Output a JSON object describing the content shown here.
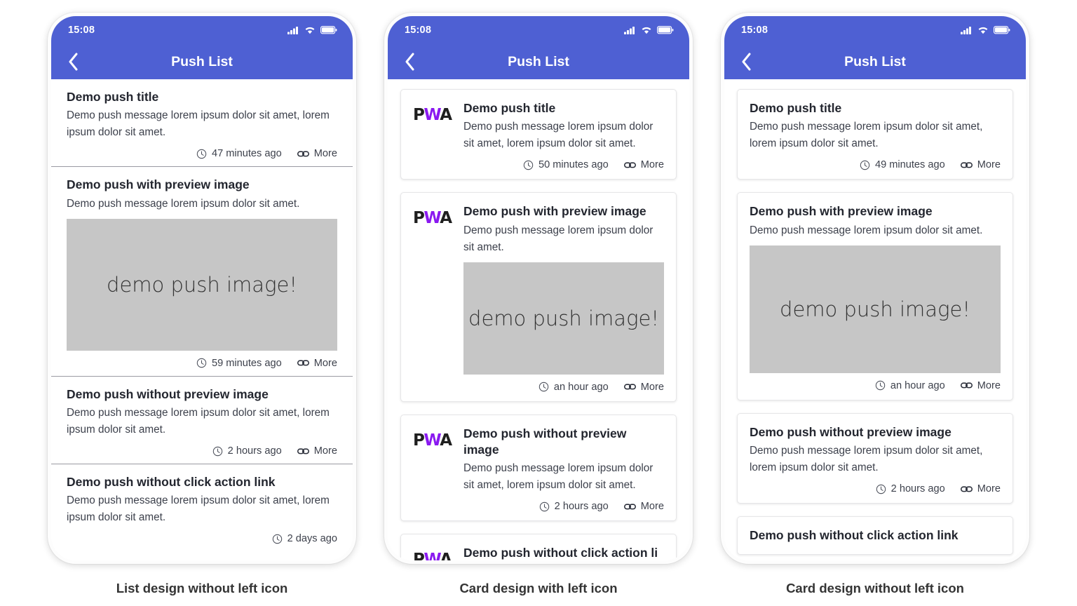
{
  "phones": [
    {
      "id": "list-design",
      "caption": "List design without left icon",
      "design": "list",
      "status": {
        "time": "15:08",
        "signal_icon": "signal-bars-icon",
        "wifi_icon": "wifi-icon",
        "battery_icon": "battery-icon"
      },
      "appbar": {
        "back_icon": "back-chevron-icon",
        "title": "Push List"
      },
      "items": [
        {
          "title": "Demo push title",
          "body": "Demo push message lorem ipsum dolor sit amet, lorem ipsum dolor sit amet.",
          "image": null,
          "time": "47 minutes ago",
          "more": "More"
        },
        {
          "title": "Demo push with preview image",
          "body": "Demo push message lorem ipsum dolor sit amet.",
          "image": "demo push image!",
          "time": "59 minutes ago",
          "more": "More"
        },
        {
          "title": "Demo push without preview image",
          "body": "Demo push message lorem ipsum dolor sit amet, lorem ipsum dolor sit amet.",
          "image": null,
          "time": "2 hours ago",
          "more": "More"
        },
        {
          "title": "Demo push without click action link",
          "body": "Demo push message lorem ipsum dolor sit amet, lorem ipsum dolor sit amet.",
          "image": null,
          "time": "2 days ago",
          "more": null
        }
      ]
    },
    {
      "id": "card-design-with-icon",
      "caption": "Card design with left icon",
      "design": "card-icon",
      "status": {
        "time": "15:08",
        "signal_icon": "signal-bars-icon",
        "wifi_icon": "wifi-icon",
        "battery_icon": "battery-icon"
      },
      "appbar": {
        "back_icon": "back-chevron-icon",
        "title": "Push List"
      },
      "logo": {
        "p": "P",
        "w": "W",
        "a": "A"
      },
      "items": [
        {
          "title": "Demo push title",
          "body": "Demo push message lorem ipsum dolor sit amet, lorem ipsum dolor sit amet.",
          "image": null,
          "time": "50 minutes ago",
          "more": "More"
        },
        {
          "title": "Demo push with preview image",
          "body": "Demo push message lorem ipsum dolor sit amet.",
          "image": "demo push image!",
          "time": "an hour ago",
          "more": "More"
        },
        {
          "title": "Demo push without preview image",
          "body": "Demo push message lorem ipsum dolor sit amet, lorem ipsum dolor sit amet.",
          "image": null,
          "time": "2 hours ago",
          "more": "More"
        },
        {
          "title": "Demo push without click action li",
          "body": null,
          "image": null,
          "time": null,
          "more": null
        }
      ]
    },
    {
      "id": "card-design-without-icon",
      "caption": "Card design without left icon",
      "design": "card-plain",
      "status": {
        "time": "15:08",
        "signal_icon": "signal-bars-icon",
        "wifi_icon": "wifi-icon",
        "battery_icon": "battery-icon"
      },
      "appbar": {
        "back_icon": "back-chevron-icon",
        "title": "Push List"
      },
      "items": [
        {
          "title": "Demo push title",
          "body": "Demo push message lorem ipsum dolor sit amet, lorem ipsum dolor sit amet.",
          "image": null,
          "time": "49 minutes ago",
          "more": "More"
        },
        {
          "title": "Demo push with preview image",
          "body": "Demo push message lorem ipsum dolor sit amet.",
          "image": "demo push image!",
          "time": "an hour ago",
          "more": "More"
        },
        {
          "title": "Demo push without preview image",
          "body": "Demo push message lorem ipsum dolor sit amet, lorem ipsum dolor sit amet.",
          "image": null,
          "time": "2 hours ago",
          "more": "More"
        },
        {
          "title": "Demo push without click action link",
          "body": null,
          "image": null,
          "time": null,
          "more": null
        }
      ]
    }
  ],
  "colors": {
    "header_blue": "#4e60d3",
    "image_placeholder": "#c6c6c6",
    "pwa_purple": "#8a19f0",
    "title_text": "#23262f",
    "body_text": "#3d414c",
    "divider": "#9a9aa2"
  }
}
